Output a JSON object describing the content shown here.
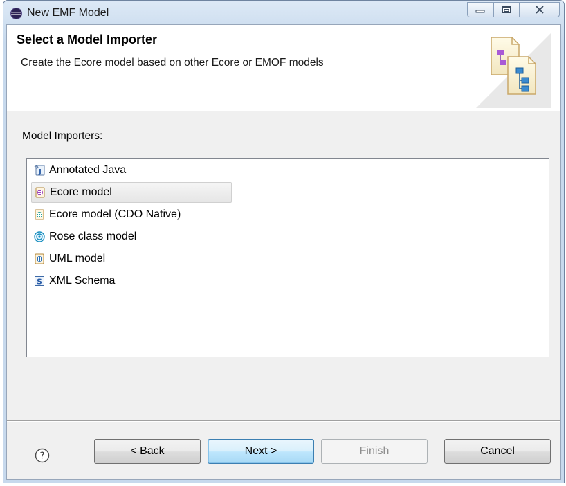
{
  "window": {
    "title": "New EMF Model",
    "controls": [
      "minimize-icon",
      "maximize-icon",
      "close-icon"
    ]
  },
  "header": {
    "title": "Select a Model Importer",
    "description": "Create the Ecore model based on other Ecore or EMOF models"
  },
  "importers": {
    "label": "Model Importers:",
    "items": [
      {
        "label": "Annotated Java",
        "icon": "annotated-java-icon"
      },
      {
        "label": "Ecore model",
        "icon": "ecore-model-icon",
        "selected": true
      },
      {
        "label": "Ecore model (CDO Native)",
        "icon": "ecore-cdo-icon"
      },
      {
        "label": "Rose class model",
        "icon": "rose-icon"
      },
      {
        "label": "UML model",
        "icon": "uml-icon"
      },
      {
        "label": "XML Schema",
        "icon": "xml-schema-icon"
      }
    ]
  },
  "footer": {
    "help_icon": "help-icon",
    "back": "< Back",
    "next": "Next >",
    "finish": "Finish",
    "cancel": "Cancel"
  },
  "colors": {
    "selection_bg": "#e8e8e8",
    "default_button": "#bee6fd",
    "disabled_text": "#8e8e8e"
  }
}
